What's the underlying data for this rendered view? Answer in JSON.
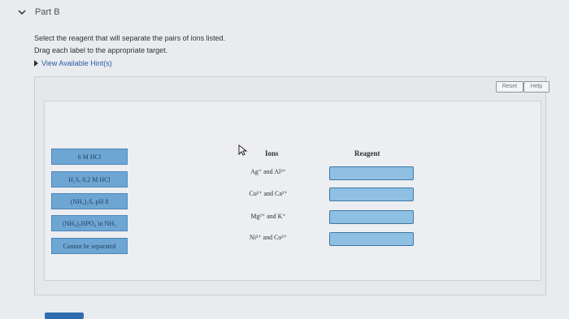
{
  "part": {
    "title": "Part B"
  },
  "instructions": {
    "line1": "Select the reagent that will separate the pairs of ions listed.",
    "line2": "Drag each label to the appropriate target."
  },
  "hints": {
    "label": "View Available Hint(s)"
  },
  "toolbar": {
    "reset_label": "Reset",
    "help_label": "Help"
  },
  "labels": [
    "6 M HCl",
    "H₂S, 0.2 M HCl",
    "(NH₄)₂S, pH 8",
    "(NH₄)₂HPO₄ in NH₃",
    "Cannot be separated"
  ],
  "table": {
    "headers": {
      "ions": "Ions",
      "reagent": "Reagent"
    },
    "rows": [
      {
        "ions": "Ag⁺ and Al³⁺"
      },
      {
        "ions": "Cu²⁺ and Ca²⁺"
      },
      {
        "ions": "Mg²⁺ and K⁺"
      },
      {
        "ions": "Ni²⁺ and Co²⁺"
      }
    ]
  },
  "icons": {
    "collapse": "chevron-down-icon",
    "pointer": "cursor-icon",
    "hint_toggle": "triangle-right-icon"
  },
  "colors": {
    "tile": "#6ea6d3",
    "drop_target": "#8fc0e3",
    "link": "#2a5aa8"
  }
}
